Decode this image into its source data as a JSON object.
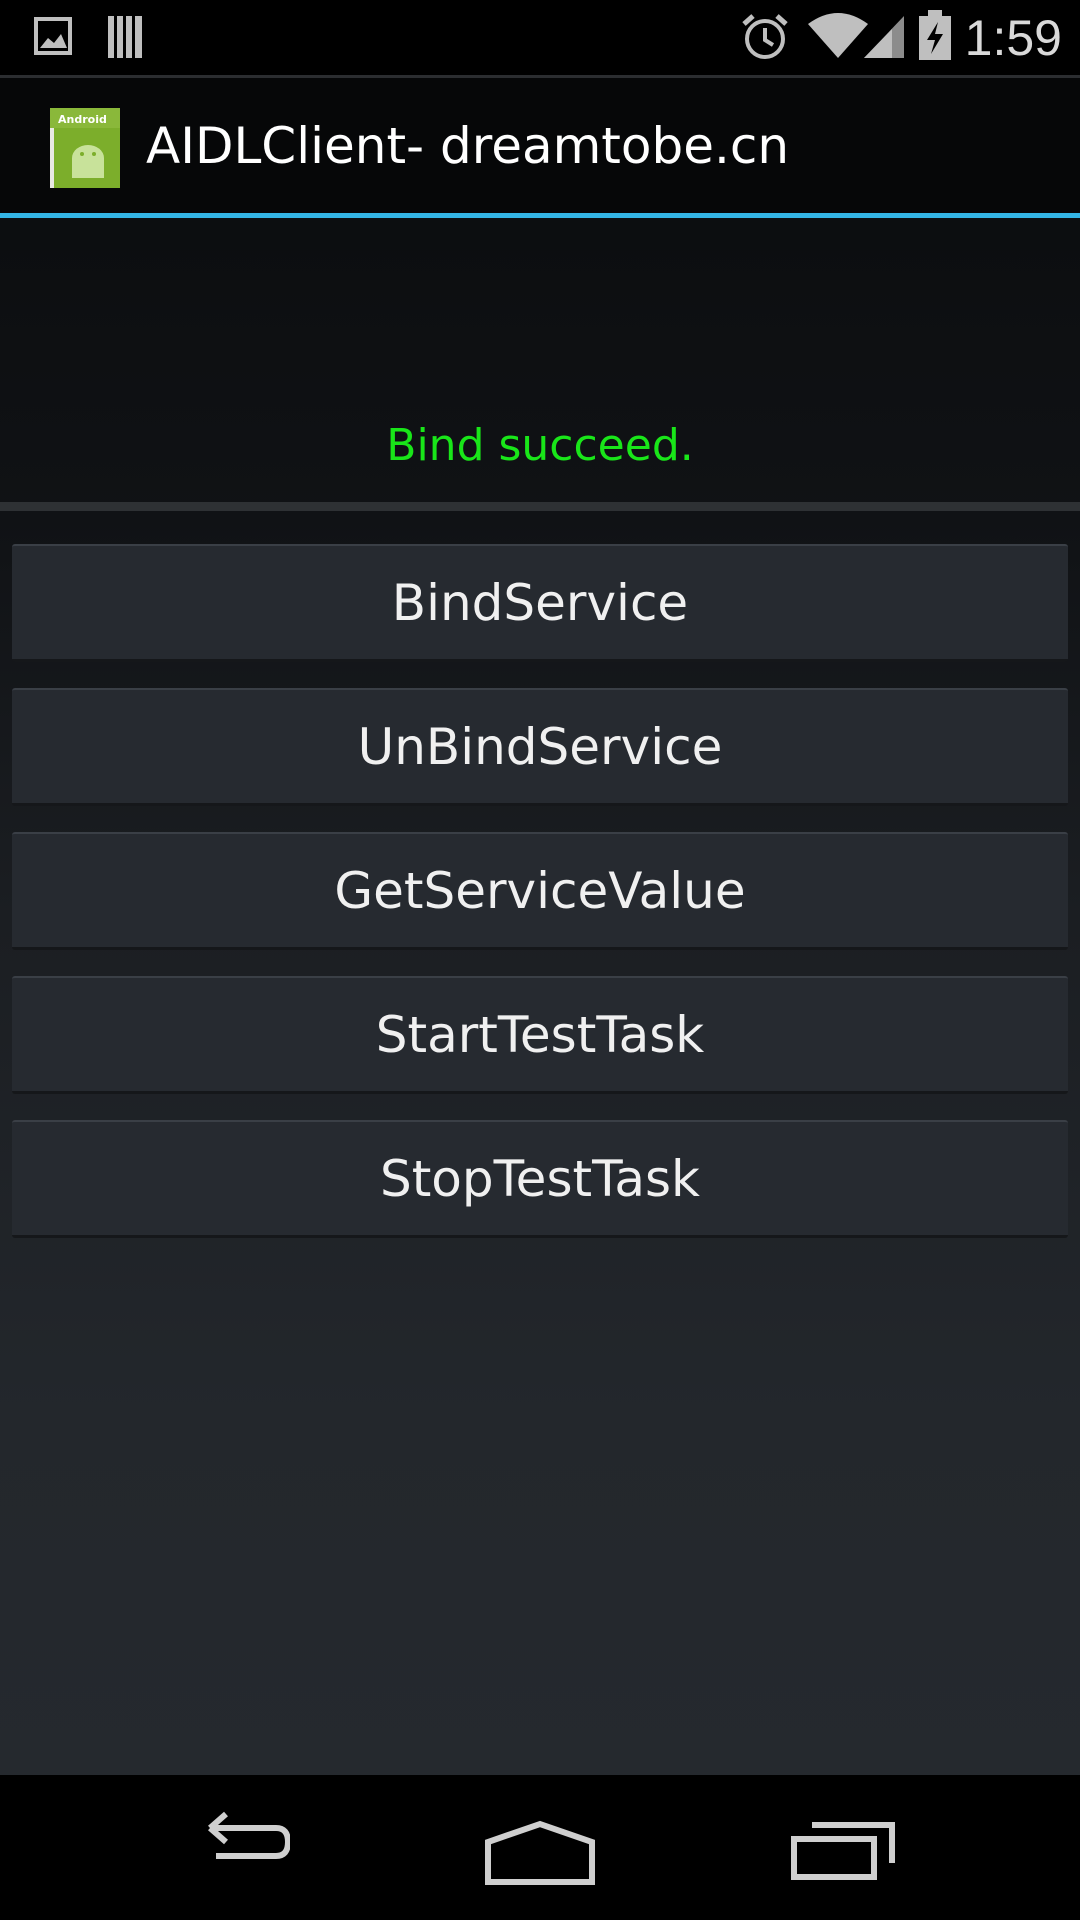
{
  "status_bar": {
    "time": "1:59",
    "icons": [
      "gallery-icon",
      "barcode-icon",
      "alarm-icon",
      "wifi-icon",
      "signal-icon",
      "battery-charging-icon"
    ]
  },
  "action_bar": {
    "title": "AIDLClient- dreamtobe.cn",
    "icon": "android-app-icon",
    "icon_badge": "Android",
    "accent_color": "#33b5e5"
  },
  "main": {
    "status_message": "Bind succeed.",
    "status_color": "#19e619",
    "buttons": [
      {
        "label": "BindService"
      },
      {
        "label": "UnBindService"
      },
      {
        "label": "GetServiceValue"
      },
      {
        "label": "StartTestTask"
      },
      {
        "label": "StopTestTask"
      }
    ]
  },
  "nav_bar": {
    "icons": [
      "back-icon",
      "home-icon",
      "recents-icon"
    ]
  }
}
